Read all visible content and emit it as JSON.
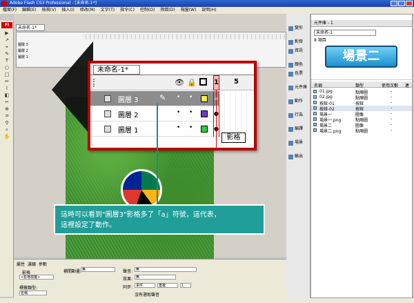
{
  "window": {
    "title": "Adobe Flash CS3 Professional - [未命名-1*]"
  },
  "menubar": [
    "檔案(F)",
    "編輯(E)",
    "檢視(V)",
    "插入(I)",
    "修改(M)",
    "文字(T)",
    "指令(C)",
    "控制(O)",
    "除錯(D)",
    "視窗(W)",
    "說明(H)"
  ],
  "toolbox": {
    "logo": "Fl",
    "tools": [
      "▶",
      "↗",
      "⌖",
      "✎",
      "T",
      "○",
      "□",
      "✏",
      "⌇",
      "◧",
      "✂",
      "⊕",
      "♒",
      "⚲",
      "⌕",
      "✋"
    ]
  },
  "document": {
    "tab_label": "未命名-1*",
    "mini_layers": [
      "圖層 3",
      "圖層 2",
      "圖層 1"
    ]
  },
  "timeline_zoom": {
    "tab_label": "未命名-1*",
    "header_frame_1": "1",
    "header_frame_5": "5",
    "layers": [
      {
        "name": "圖層 3",
        "selected": true,
        "color": "#f5f03c",
        "frame_symbol": "a"
      },
      {
        "name": "圖層 2",
        "selected": false,
        "color": "#6a3cc0",
        "frame_symbol": ""
      },
      {
        "name": "圖層 1",
        "selected": false,
        "color": "#2ecc40",
        "frame_symbol": ""
      }
    ],
    "tooltip": "影格"
  },
  "callout": {
    "line1": "這時可以看到\"圖層3\"影格多了「a」符號，這代表，",
    "line2": "這裡設定了動作。"
  },
  "properties": {
    "tabs": [
      "屬性",
      "濾鏡",
      "參數"
    ],
    "frame_label": "影格",
    "frame_name_placeholder": "<影格標籤>",
    "tween_label": "補間動畫:",
    "tween_value": "無",
    "sound_label": "聲音:",
    "sound_value": "無",
    "effect_label": "效果:",
    "effect_value": "無",
    "label_type_label": "標籤類型:",
    "label_type_value": "名稱",
    "sync_label": "同步:",
    "sync_value": "事件",
    "repeat_value": "重複",
    "repeat_count": "1",
    "no_sound": "沒有選取聲音"
  },
  "dock": [
    "變形",
    "對齊",
    "資訊",
    "顏色",
    "色票",
    "元件庫",
    "動作",
    "行為",
    "編譯",
    "場景",
    "輸出"
  ],
  "library": {
    "title": "元件庫 - 1",
    "select_value": "未命名-1",
    "count": "8 項目",
    "preview_text": "場景二",
    "columns": {
      "name": "名稱",
      "type": "類型",
      "uses": "使用次數",
      "link": "連"
    },
    "items": [
      {
        "name": "01.jpg",
        "type": "點陣圖",
        "uses": "-",
        "highlight": false
      },
      {
        "name": "02.jpg",
        "type": "點陣圖",
        "uses": "-",
        "highlight": false
      },
      {
        "name": "按鈕-01",
        "type": "按鈕",
        "uses": "-",
        "highlight": false
      },
      {
        "name": "按鈕-02",
        "type": "按鈕",
        "uses": "-",
        "highlight": true
      },
      {
        "name": "場景一",
        "type": "圖像",
        "uses": "-",
        "highlight": false
      },
      {
        "name": "場景一.png",
        "type": "點陣圖",
        "uses": "-",
        "highlight": false
      },
      {
        "name": "場景二",
        "type": "圖像",
        "uses": "-",
        "highlight": false
      },
      {
        "name": "場景二.png",
        "type": "點陣圖",
        "uses": "-",
        "highlight": false
      }
    ]
  }
}
